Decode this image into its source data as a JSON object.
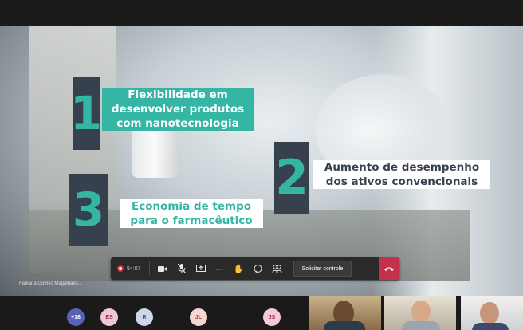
{
  "slide": {
    "items": [
      {
        "number": "1",
        "label": "Flexibilidade em desenvolver produtos com nanotecnologia"
      },
      {
        "number": "2",
        "label": "Aumento de desempenho dos ativos convencionais"
      },
      {
        "number": "3",
        "label": "Economia de tempo para o farmacêutico"
      }
    ],
    "colors": {
      "teal": "#35b6a4",
      "navy": "#36414d"
    }
  },
  "presenter": {
    "name": "Fabiana Gomes Magalhães..."
  },
  "toolbar": {
    "timer": "54:07",
    "solicitar_label": "Solicitar controle",
    "icons": [
      "video-camera-icon",
      "mic-muted-icon",
      "share-screen-icon",
      "more-icon",
      "raise-hand-icon",
      "chat-icon",
      "participants-icon",
      "hang-up-icon"
    ],
    "colors": {
      "hangup": "#c4314b",
      "record": "#c2374b"
    }
  },
  "participants": {
    "avatars": [
      {
        "initials": "+18",
        "color": "#5a61b6"
      },
      {
        "initials": "ES",
        "color": "#f1c6d4"
      },
      {
        "initials": "R",
        "color": "#cfd6e8"
      },
      {
        "initials": "JL",
        "color": "#f5d6d0"
      },
      {
        "initials": "JS",
        "color": "#f6c8da"
      }
    ]
  }
}
